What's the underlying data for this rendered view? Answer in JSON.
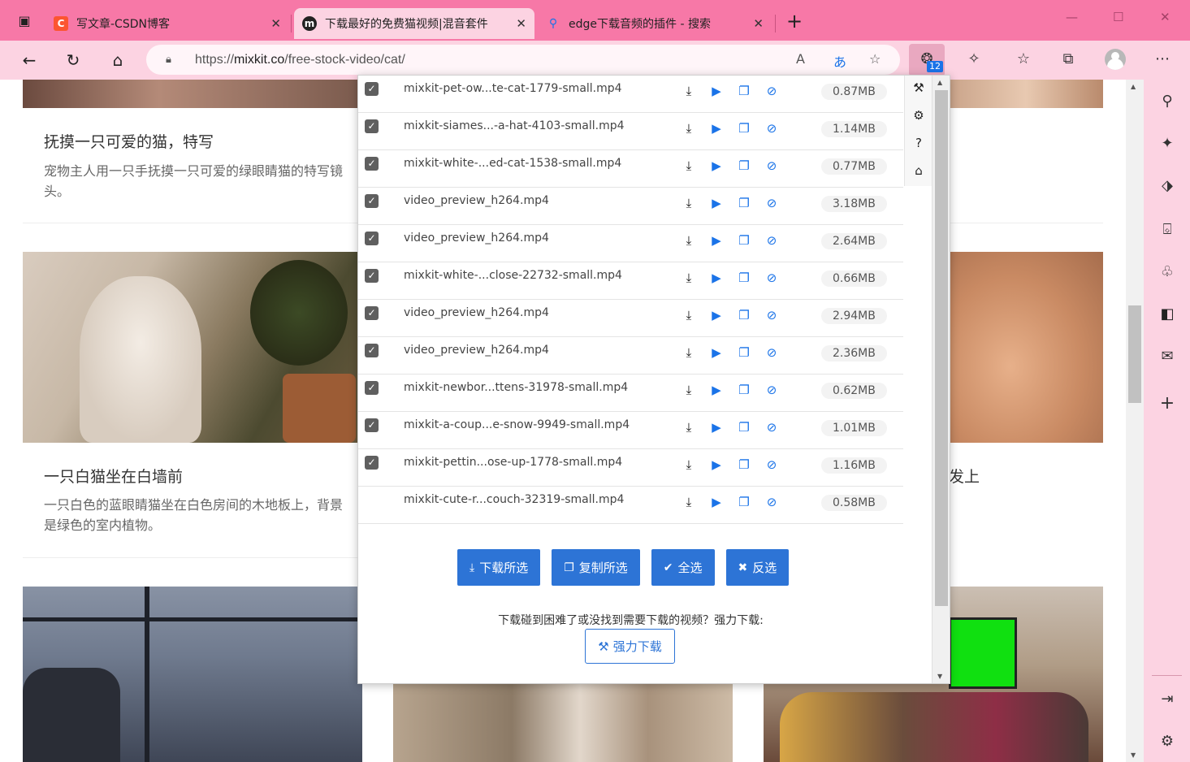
{
  "tabs": [
    {
      "title": "写文章-CSDN博客",
      "icon": "C",
      "color": "#fc5531"
    },
    {
      "title": "下载最好的免费猫视频|混音套件",
      "icon": "m",
      "color": "#222222"
    },
    {
      "title": "edge下载音频的插件 - 搜索",
      "icon": "search-icon",
      "color": "#1a73e8"
    }
  ],
  "new_tab_label": "+",
  "address": {
    "prefix": "https://",
    "host": "mixkit.co",
    "path": "/free-stock-video/cat/"
  },
  "extension_badge": "12",
  "page": {
    "cards": [
      {
        "title": "抚摸一只可爱的猫，特写",
        "desc": "宠物主人用一只手抚摸一只可爱的绿眼睛猫的特写镜头。"
      },
      {
        "title": "一只白猫坐在白墙前",
        "desc": "一只白色的蓝眼睛猫坐在白色房间的木地板上，背景是绿色的室内植物。"
      },
      {
        "title_fragment": "发上"
      }
    ]
  },
  "popup": {
    "rows": [
      {
        "checked": true,
        "name": "mixkit-pet-ow...te-cat-1779-small.mp4",
        "size": "0.87MB"
      },
      {
        "checked": true,
        "name": "mixkit-siames...-a-hat-4103-small.mp4",
        "size": "1.14MB"
      },
      {
        "checked": true,
        "name": "mixkit-white-...ed-cat-1538-small.mp4",
        "size": "0.77MB"
      },
      {
        "checked": true,
        "name": "video_preview_h264.mp4",
        "size": "3.18MB"
      },
      {
        "checked": true,
        "name": "video_preview_h264.mp4",
        "size": "2.64MB"
      },
      {
        "checked": true,
        "name": "mixkit-white-...close-22732-small.mp4",
        "size": "0.66MB"
      },
      {
        "checked": true,
        "name": "video_preview_h264.mp4",
        "size": "2.94MB"
      },
      {
        "checked": true,
        "name": "video_preview_h264.mp4",
        "size": "2.36MB"
      },
      {
        "checked": true,
        "name": "mixkit-newbor...ttens-31978-small.mp4",
        "size": "0.62MB"
      },
      {
        "checked": true,
        "name": "mixkit-a-coup...e-snow-9949-small.mp4",
        "size": "1.01MB"
      },
      {
        "checked": true,
        "name": "mixkit-pettin...ose-up-1778-small.mp4",
        "size": "1.16MB"
      },
      {
        "checked": false,
        "name": "mixkit-cute-r...couch-32319-small.mp4",
        "size": "0.58MB"
      }
    ],
    "buttons": {
      "download_selected": "下载所选",
      "copy_selected": "复制所选",
      "select_all": "全选",
      "invert": "反选"
    },
    "hint": "下载碰到困难了或没找到需要下载的视频？强力下载:",
    "force_download": "强力下载"
  },
  "colors": {
    "accent": "#2d74d6",
    "chrome": "#f778a7",
    "chrome_light": "#fcd3e2"
  }
}
